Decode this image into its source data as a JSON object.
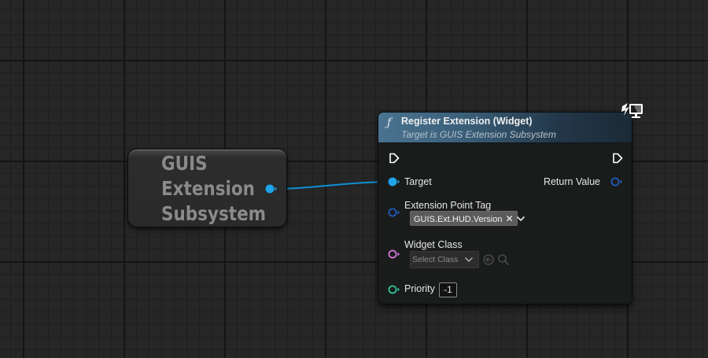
{
  "getter_node": {
    "title_lines": [
      "GUIS",
      "Extension",
      "Subsystem"
    ]
  },
  "function_node": {
    "icon": "function-icon",
    "title": "Register Extension (Widget)",
    "subtitle": "Target is GUIS Extension Subsystem",
    "corner_icon": "networked-monitor-icon",
    "pins": {
      "exec_in": "exec-pin-icon",
      "exec_out": "exec-pin-icon",
      "target_label": "Target",
      "return_value_label": "Return Value",
      "extension_point_tag_label": "Extension Point Tag",
      "extension_point_tag_value": "GUIS.Ext.HUD.Version",
      "widget_class_label": "Widget Class",
      "widget_class_placeholder": "Select Class",
      "priority_label": "Priority",
      "priority_value": "-1"
    }
  },
  "colors": {
    "canvas_background": "#262626",
    "object_pin": "#1fa3ea",
    "struct_pin": "#1f62c8",
    "class_pin": "#e07ee6",
    "int_pin": "#2fd1a2",
    "exec_pin": "#ffffff",
    "header_gradient_start": "#4a7390"
  }
}
